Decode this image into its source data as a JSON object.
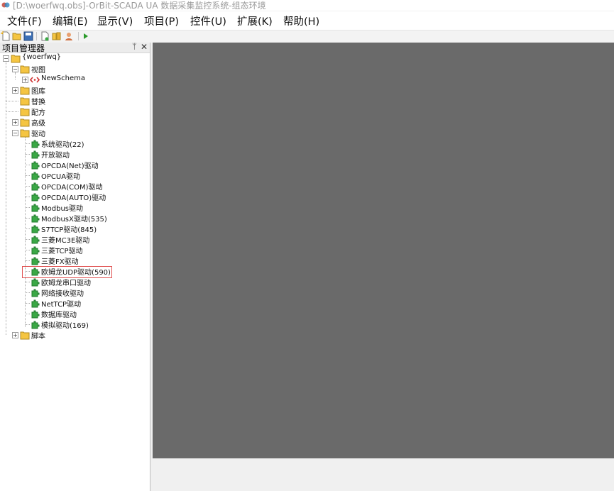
{
  "window": {
    "title": "[D:\\woerfwq.obs]-OrBit-SCADA UA 数据采集监控系统-组态环境"
  },
  "menu": [
    {
      "label": "文件(F)"
    },
    {
      "label": "编辑(E)"
    },
    {
      "label": "显示(V)"
    },
    {
      "label": "项目(P)"
    },
    {
      "label": "控件(U)"
    },
    {
      "label": "扩展(K)"
    },
    {
      "label": "帮助(H)"
    }
  ],
  "toolbar": {
    "buttons": [
      "new-file-icon",
      "open-folder-icon",
      "save-icon",
      "new-page-icon",
      "library-icon",
      "user-icon",
      "run-icon"
    ]
  },
  "panel": {
    "title": "项目管理器",
    "pin": "ᛘ",
    "close": "✕"
  },
  "tree": {
    "root": "{woerfwq}",
    "view": "视图",
    "newschema": "NewSchema",
    "library": "图库",
    "replace": "替换",
    "recipe": "配方",
    "advanced": "高级",
    "drivers": "驱动",
    "driver_items": [
      "系统驱动(22)",
      "开放驱动",
      "OPCDA(Net)驱动",
      "OPCUA驱动",
      "OPCDA(COM)驱动",
      "OPCDA(AUTO)驱动",
      "Modbus驱动",
      "ModbusX驱动(535)",
      "S7TCP驱动(845)",
      "三菱MC3E驱动",
      "三菱TCP驱动",
      "三菱FX驱动",
      "欧姆龙UDP驱动(590)",
      "欧姆龙串口驱动",
      "网络接收驱动",
      "NetTCP驱动",
      "数据库驱动",
      "模拟驱动(169)"
    ],
    "script": "脚本"
  },
  "colors": {
    "workspace": "#6a6a6a",
    "highlight": "#e05050",
    "folder": "#f5c542",
    "plugin": "#3aa845"
  }
}
